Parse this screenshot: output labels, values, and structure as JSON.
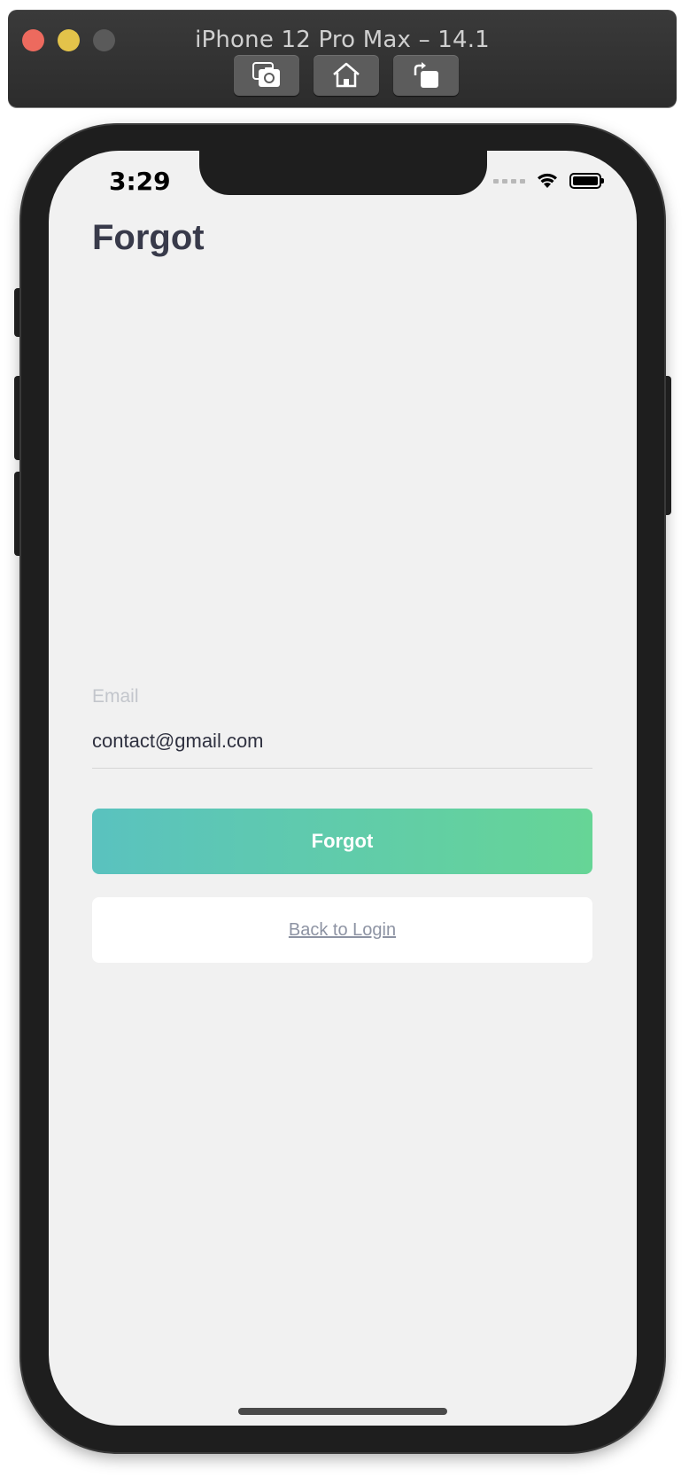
{
  "simulator": {
    "title": "iPhone 12 Pro Max – 14.1",
    "toolbar": [
      "screenshot-icon",
      "home-icon",
      "rotate-icon"
    ]
  },
  "status_bar": {
    "time": "3:29"
  },
  "page": {
    "title": "Forgot"
  },
  "form": {
    "email_label": "Email",
    "email_value": "contact@gmail.com",
    "submit_label": "Forgot",
    "back_label": "Back to Login"
  },
  "colors": {
    "title": "#383a4a",
    "button_gradient_start": "#5ac2bf",
    "button_gradient_end": "#66d596",
    "screen_bg": "#f1f1f1"
  }
}
